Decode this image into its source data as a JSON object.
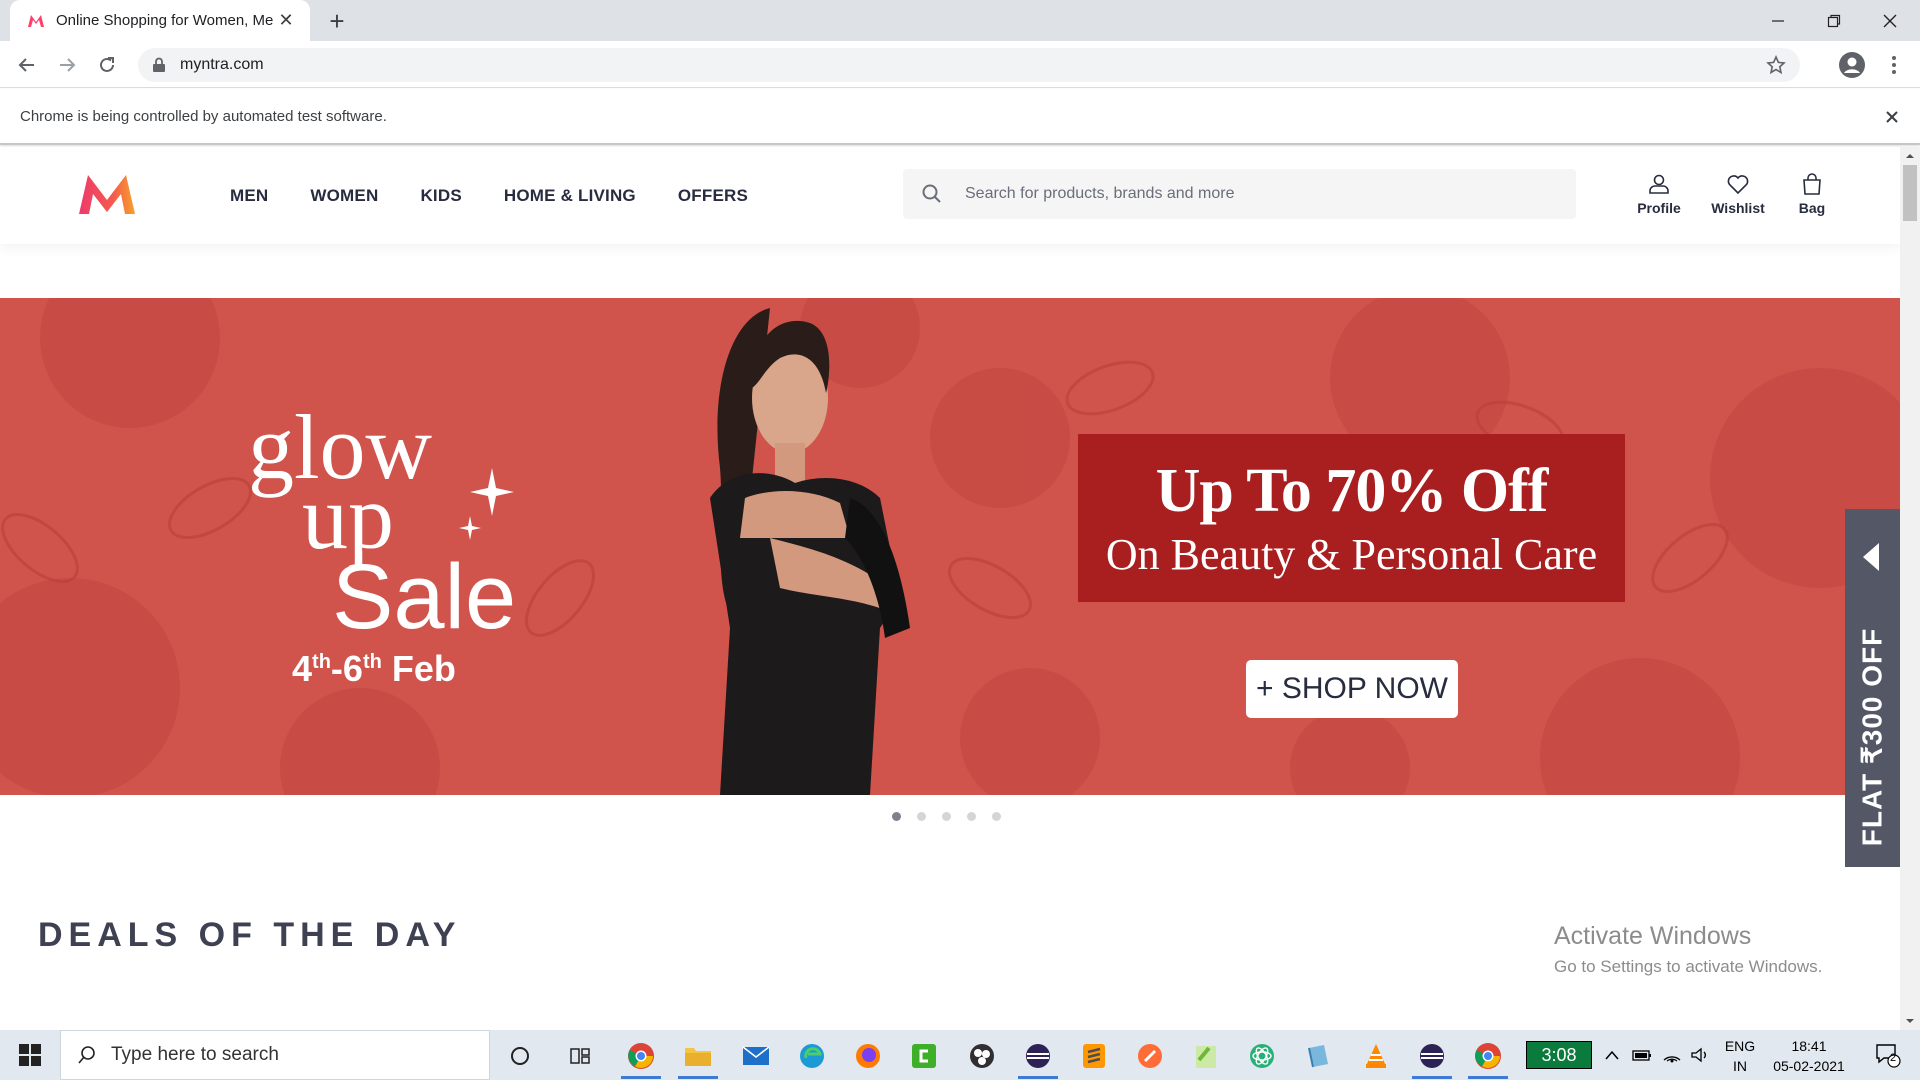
{
  "browser": {
    "tab_title": "Online Shopping for Women, Me",
    "url": "myntra.com",
    "infobar": "Chrome is being controlled by automated test software."
  },
  "header": {
    "nav": [
      "MEN",
      "WOMEN",
      "KIDS",
      "HOME & LIVING",
      "OFFERS"
    ],
    "search_placeholder": "Search for products, brands and more",
    "actions": {
      "profile": "Profile",
      "wishlist": "Wishlist",
      "bag": "Bag"
    }
  },
  "banner": {
    "sale_title_line1": "glow",
    "sale_title_line2": "up",
    "sale_title_line3": "Sale",
    "dates_start": "4",
    "dates_start_sup": "th",
    "dates_end": "6",
    "dates_end_sup": "th",
    "dates_month": "Feb",
    "offer_line1": "Up To 70% Off",
    "offer_line2": "On Beauty & Personal  Care",
    "cta": "+ SHOP NOW",
    "slide_count": 5,
    "active_slide": 1
  },
  "side_offer": {
    "text": "FLAT ₹300 OFF"
  },
  "sections": {
    "deals_title": "DEALS OF THE DAY"
  },
  "watermark": {
    "line1": "Activate Windows",
    "line2": "Go to Settings to activate Windows."
  },
  "taskbar": {
    "search_placeholder": "Type here to search",
    "green_clock": "3:08",
    "lang_line1": "ENG",
    "lang_line2": "IN",
    "time": "18:41",
    "date": "05-02-2021",
    "notification_count": "2"
  },
  "colors": {
    "banner_bg": "#d0534c",
    "offer_box": "#a91e1f",
    "side_tab": "#535766",
    "brand_pink": "#ff3f6c",
    "brand_orange": "#f79a2a"
  }
}
